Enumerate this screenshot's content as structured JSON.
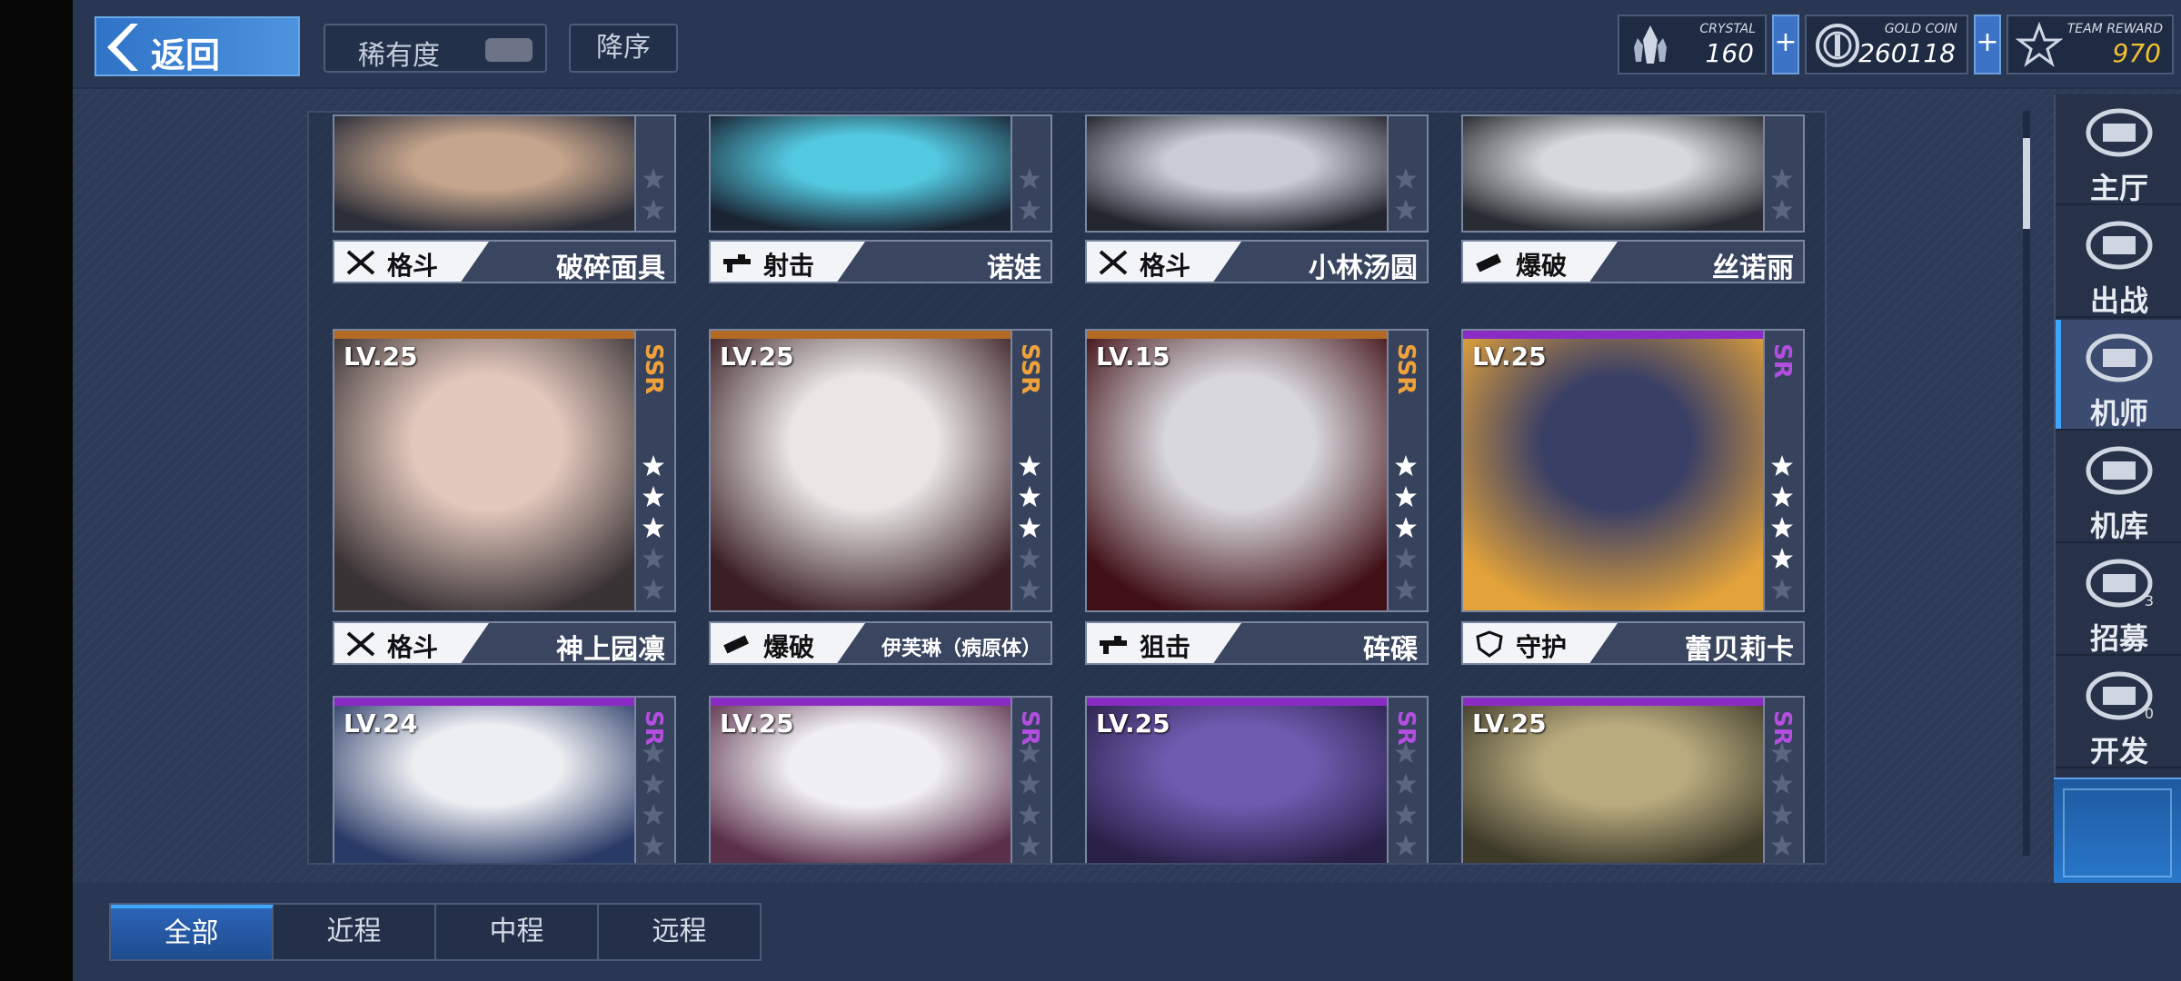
{
  "header": {
    "back_label": "返回",
    "rarity_label": "稀有度",
    "sort_label": "降序"
  },
  "resources": [
    {
      "name": "CRYSTAL",
      "value": "160",
      "icon": "crystal-icon"
    },
    {
      "name": "GOLD COIN",
      "value": "260118",
      "icon": "gold-coin-icon"
    },
    {
      "name": "TEAM REWARD",
      "value": "970",
      "icon": "team-reward-icon"
    }
  ],
  "plus_symbol": "+",
  "cards": [
    {
      "level": "",
      "rarity": "",
      "stars": 3,
      "type": "格斗",
      "name": "破碎面具",
      "palette": [
        "#c5a58c",
        "#2c2f3a"
      ]
    },
    {
      "level": "",
      "rarity": "",
      "stars": 3,
      "type": "射击",
      "name": "诺娃",
      "palette": [
        "#53c9e0",
        "#1a2433"
      ]
    },
    {
      "level": "",
      "rarity": "",
      "stars": 3,
      "type": "格斗",
      "name": "小林汤圆",
      "palette": [
        "#c9ccd6",
        "#23252f"
      ]
    },
    {
      "level": "",
      "rarity": "",
      "stars": 3,
      "type": "爆破",
      "name": "丝诺丽",
      "palette": [
        "#d7d8dc",
        "#2a2c33"
      ]
    },
    {
      "level": "LV.25",
      "rarity": "SSR",
      "stars": 3,
      "type": "格斗",
      "name": "神上园凛",
      "palette": [
        "#e3c9bd",
        "#3a3336"
      ]
    },
    {
      "level": "LV.25",
      "rarity": "SSR",
      "stars": 3,
      "type": "爆破",
      "name": "伊芙琳（病原体）",
      "palette": [
        "#e9e6e6",
        "#3a1f24"
      ]
    },
    {
      "level": "LV.15",
      "rarity": "SSR",
      "stars": 3,
      "type": "狙击",
      "name": "砗磲",
      "palette": [
        "#d8d8dc",
        "#401016"
      ]
    },
    {
      "level": "LV.25",
      "rarity": "SR",
      "stars": 4,
      "type": "守护",
      "name": "蕾贝莉卡",
      "palette": [
        "#3a3f66",
        "#e4a33a"
      ]
    },
    {
      "level": "LV.24",
      "rarity": "SR",
      "stars": 0,
      "type": "",
      "name": "",
      "palette": [
        "#eceef2",
        "#2a3a66"
      ]
    },
    {
      "level": "LV.25",
      "rarity": "SR",
      "stars": 0,
      "type": "",
      "name": "",
      "palette": [
        "#f0f0f3",
        "#5a2f4a"
      ]
    },
    {
      "level": "LV.25",
      "rarity": "SR",
      "stars": 0,
      "type": "",
      "name": "",
      "palette": [
        "#6f5bb0",
        "#2a2148"
      ]
    },
    {
      "level": "LV.25",
      "rarity": "SR",
      "stars": 0,
      "type": "",
      "name": "",
      "palette": [
        "#b9ab7e",
        "#3d3a2a"
      ]
    }
  ],
  "colors": {
    "ssr": "#f0a23a",
    "ssr_line": "#b36a24",
    "sr": "#b34ee0",
    "sr_line": "#8a2bc6"
  },
  "nav": [
    {
      "label": "主厅",
      "icon": "lobby-icon",
      "active": false,
      "count": ""
    },
    {
      "label": "出战",
      "icon": "sortie-icon",
      "active": false,
      "count": ""
    },
    {
      "label": "机师",
      "icon": "pilot-icon",
      "active": true,
      "count": ""
    },
    {
      "label": "机库",
      "icon": "hangar-icon",
      "active": false,
      "count": ""
    },
    {
      "label": "招募",
      "icon": "recruit-icon",
      "active": false,
      "count": "3"
    },
    {
      "label": "开发",
      "icon": "develop-icon",
      "active": false,
      "count": "0"
    }
  ],
  "tabs": [
    {
      "label": "全部",
      "active": true
    },
    {
      "label": "近程",
      "active": false
    },
    {
      "label": "中程",
      "active": false
    },
    {
      "label": "远程",
      "active": false
    }
  ]
}
